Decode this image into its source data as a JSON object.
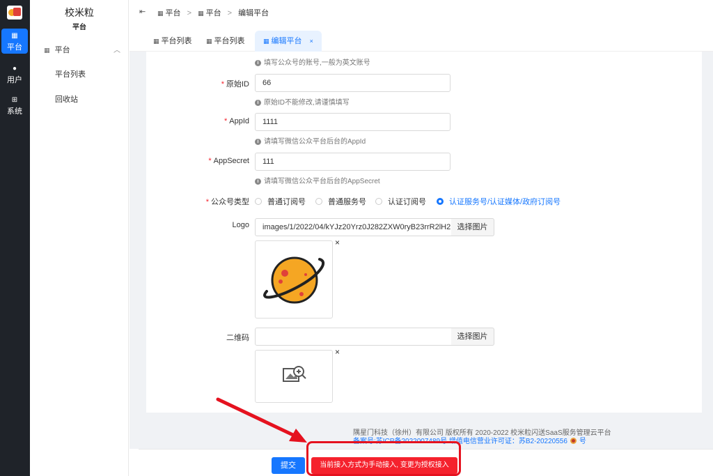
{
  "rail": {
    "items": [
      {
        "label": "平台",
        "icon": "grid-icon"
      },
      {
        "label": "用户",
        "icon": "user-icon"
      },
      {
        "label": "系统",
        "icon": "windows-icon"
      }
    ]
  },
  "sidebar": {
    "brand": "校米粒",
    "subtitle": "平台",
    "group_label": "平台",
    "items": [
      {
        "label": "平台列表"
      },
      {
        "label": "回收站"
      }
    ]
  },
  "header": {
    "breadcrumbs": [
      "平台",
      "平台",
      "编辑平台"
    ]
  },
  "tabs": [
    {
      "label": "平台列表"
    },
    {
      "label": "平台列表"
    },
    {
      "label": "编辑平台",
      "close": "×"
    }
  ],
  "form": {
    "account_hint": "填写公众号的账号,一般为英文账号",
    "original_id": {
      "label": "原始ID",
      "value": "66",
      "hint": "原始ID不能修改,请谨慎填写"
    },
    "app_id": {
      "label": "AppId",
      "value": "1111",
      "hint": "请填写微信公众平台后台的AppId"
    },
    "app_secret": {
      "label": "AppSecret",
      "value": "111",
      "hint": "请填写微信公众平台后台的AppSecret"
    },
    "account_type": {
      "label": "公众号类型",
      "options": [
        "普通订阅号",
        "普通服务号",
        "认证订阅号",
        "认证服务号/认证媒体/政府订阅号"
      ],
      "selected": "认证服务号/认证媒体/政府订阅号"
    },
    "logo": {
      "label": "Logo",
      "value": "images/1/2022/04/kYJz20Yrz0J282ZXW0ryB23rrR2lH2.",
      "button": "选择图片"
    },
    "qrcode": {
      "label": "二维码",
      "value": "",
      "button": "选择图片"
    },
    "image_close": "×"
  },
  "footer": {
    "copyright": "隅星门科技（徐州）有限公司 版权所有 2020-2022 校米粒闪送SaaS服务管理云平台",
    "icp": "备案号:苏ICP备2022007489号 增值电信营业许可证：苏B2-20220556",
    "icp_suffix": "号"
  },
  "actions": {
    "submit": "提交",
    "switch": "当前接入方式为手动接入, 变更为授权接入"
  },
  "colors": {
    "accent": "#1677ff",
    "danger": "#f5222d",
    "rail_bg": "#1f2329",
    "annotation": "#e5121f"
  }
}
